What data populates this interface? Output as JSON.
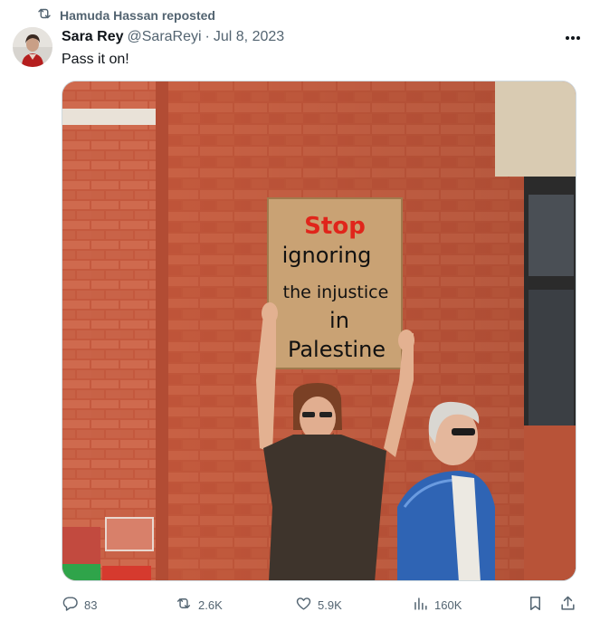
{
  "repost": {
    "text": "Hamuda Hassan reposted",
    "icon": "repost-icon"
  },
  "tweet": {
    "author_name": "Sara Rey",
    "author_handle": "@SaraReyi",
    "separator": "·",
    "date": "Jul 8, 2023",
    "text": "Pass it on!",
    "more_icon": "more-icon"
  },
  "media": {
    "sign_lines": [
      "Stop",
      "ignoring",
      "the injustice",
      "in",
      "Palestine"
    ],
    "sign_colors": {
      "stop": "#e0251b",
      "text": "#111111"
    }
  },
  "actions": {
    "replies": "83",
    "reposts": "2.6K",
    "likes": "5.9K",
    "views": "160K",
    "icons": [
      "reply-icon",
      "repost-icon",
      "like-icon",
      "views-icon",
      "bookmark-icon",
      "share-icon"
    ]
  },
  "colors": {
    "text_primary": "#0f1419",
    "text_secondary": "#536471",
    "border": "#cfd9de"
  }
}
